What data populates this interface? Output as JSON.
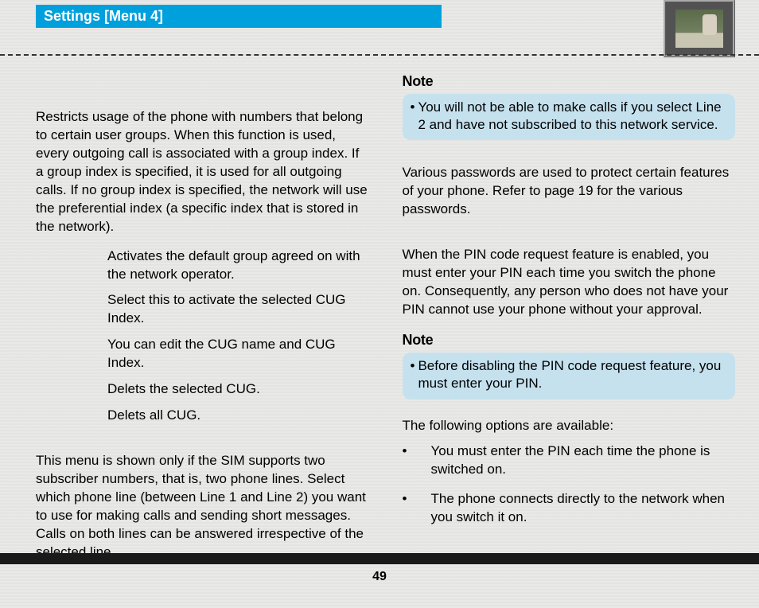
{
  "header": {
    "title": "Settings [Menu 4]"
  },
  "left": {
    "p1": "Restricts usage of the phone with numbers that belong to certain user groups. When this function is used, every outgoing call is associated with a group index. If a group index is specified, it is used for all outgoing calls. If no group index is specified, the network will use the preferential index (a specific index that is stored in the network).",
    "items": [
      "Activates the default group agreed on with the network operator.",
      "Select this to activate the selected CUG Index.",
      "You can edit the CUG name and CUG Index.",
      "Delets the selected CUG.",
      "Delets all CUG."
    ],
    "p2": "This menu is shown only if the SIM supports two subscriber numbers, that is, two phone lines. Select which phone line (between Line 1 and Line 2) you want to use for making calls and sending short messages. Calls on both lines can be answered irrespective of the selected line."
  },
  "right": {
    "note1_title": "Note",
    "note1_text": "You will not be able to make calls if you select Line 2 and have not subscribed to this network service.",
    "p1": "Various passwords are used to protect certain features of your phone. Refer to page 19 for the various passwords.",
    "p2": "When the PIN code request feature is enabled, you must enter your PIN each time you switch the phone on. Consequently, any person who does not have your PIN cannot use your phone without your approval.",
    "note2_title": "Note",
    "note2_text": "Before disabling the PIN code request feature, you must enter your PIN.",
    "opts_intro": "The following options are available:",
    "opts": [
      "You must enter the PIN each time the phone is switched on.",
      "The phone connects directly to the network when you switch it on."
    ]
  },
  "page": "49"
}
